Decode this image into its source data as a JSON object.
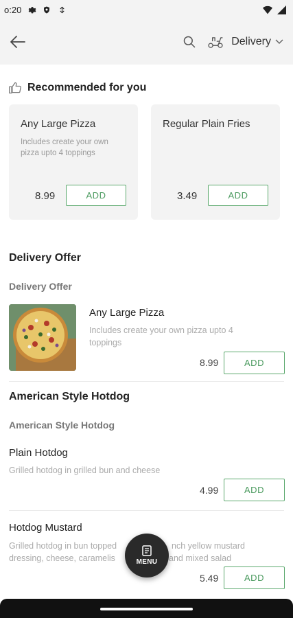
{
  "status_bar": {
    "time": "o:20"
  },
  "app_bar": {
    "delivery_label": "Delivery"
  },
  "recommended": {
    "title": "Recommended for you",
    "cards": [
      {
        "name": "Any Large Pizza",
        "desc": "Includes create your own pizza upto 4 toppings",
        "price": "8.99",
        "add_label": "ADD"
      },
      {
        "name": "Regular Plain Fries",
        "desc": "",
        "price": "3.49",
        "add_label": "ADD"
      }
    ]
  },
  "sections": [
    {
      "title": "Delivery Offer",
      "subtitle": "Delivery Offer",
      "items": [
        {
          "name": "Any Large Pizza",
          "desc": "Includes create your own pizza upto 4 toppings",
          "price": "8.99",
          "add_label": "ADD"
        }
      ]
    },
    {
      "title": "American Style Hotdog",
      "subtitle": "American Style Hotdog",
      "items": [
        {
          "name": "Plain Hotdog",
          "desc": "Grilled hotdog in grilled bun and cheese",
          "price": "4.99",
          "add_label": "ADD"
        },
        {
          "name": "Hotdog Mustard",
          "desc_line1": "Grilled hotdog in bun topped",
          "desc_line1_end": "nch yellow mustard",
          "desc_line2": "dressing, cheese, caramelis",
          "desc_line2_end": "and mixed salad",
          "price": "5.49",
          "add_label": "ADD"
        }
      ]
    }
  ],
  "menu_fab": {
    "label": "MENU"
  },
  "colors": {
    "accent_green": "#5aa86c",
    "fab_bg": "#2a2a2a",
    "card_bg": "#f3f3f3"
  }
}
